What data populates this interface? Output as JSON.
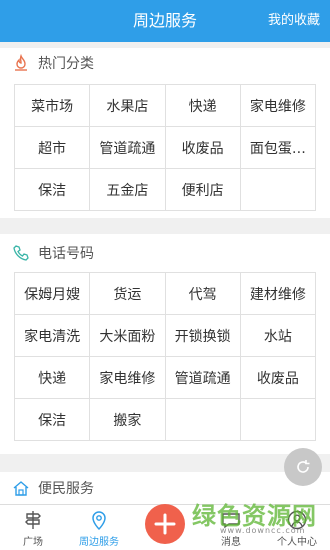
{
  "header": {
    "title": "周边服务",
    "favorites_label": "我的收藏"
  },
  "hot": {
    "title": "热门分类",
    "items": [
      "菜市场",
      "水果店",
      "快递",
      "家电维修",
      "超市",
      "管道疏通",
      "收废品",
      "面包蛋…",
      "保洁",
      "五金店",
      "便利店",
      ""
    ]
  },
  "phone": {
    "title": "电话号码",
    "items": [
      "保姆月嫂",
      "货运",
      "代驾",
      "建材维修",
      "家电清洗",
      "大米面粉",
      "开锁换锁",
      "水站",
      "快递",
      "家电维修",
      "管道疏通",
      "收废品",
      "保洁",
      "搬家",
      "",
      ""
    ]
  },
  "service": {
    "title": "便民服务"
  },
  "tabs": [
    {
      "label": "广场",
      "icon": "signpost-icon"
    },
    {
      "label": "周边服务",
      "icon": "location-pin-icon"
    },
    {
      "label": "",
      "icon": "plus-icon"
    },
    {
      "label": "消息",
      "icon": "message-icon"
    },
    {
      "label": "个人中心",
      "icon": "person-icon"
    }
  ],
  "watermark": {
    "text": "绿色资源网",
    "url": "www.downcc.com"
  },
  "colors": {
    "header": "#2f9ee8",
    "accent_red": "#f0614c",
    "active_tab": "#2f9ee8"
  }
}
